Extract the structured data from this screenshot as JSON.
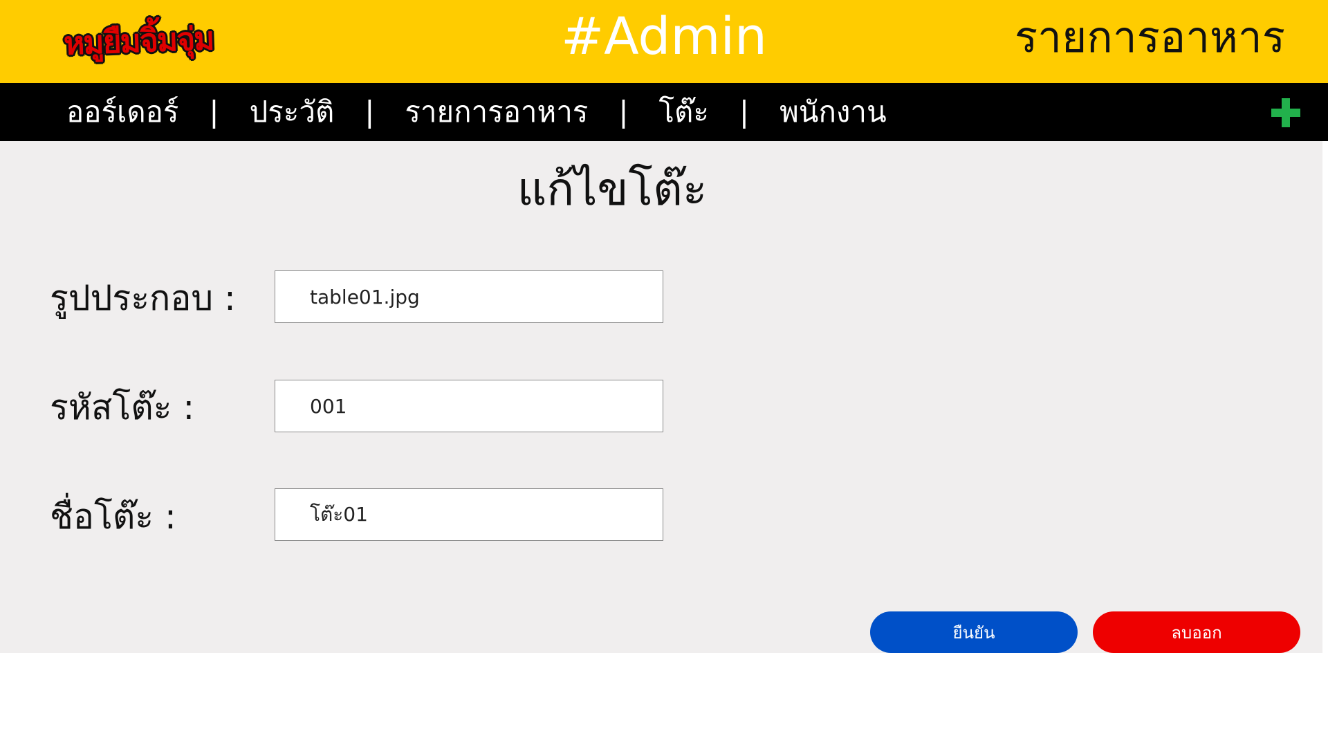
{
  "header": {
    "logo_text": "หมูยืมจิ้มจุ่ม",
    "title": "#Admin",
    "page_heading": "รายการอาหาร"
  },
  "nav": {
    "items": [
      {
        "label": "ออร์เดอร์"
      },
      {
        "label": "ประวัติ"
      },
      {
        "label": "รายการอาหาร"
      },
      {
        "label": "โต๊ะ"
      },
      {
        "label": "พนักงาน"
      }
    ],
    "separator": "|",
    "add_icon": "plus-icon",
    "add_icon_color": "#22b14c"
  },
  "form": {
    "title": "แก้ไขโต๊ะ",
    "fields": [
      {
        "label": "รูปประกอบ :",
        "value": "table01.jpg"
      },
      {
        "label": "รหัสโต๊ะ :",
        "value": "001"
      },
      {
        "label": "ชื่อโต๊ะ :",
        "value": "โต๊ะ01"
      }
    ],
    "confirm_label": "ยืนยัน",
    "delete_label": "ลบออก"
  },
  "colors": {
    "header_bg": "#FFCC00",
    "nav_bg": "#000000",
    "content_bg": "#F0EEEE",
    "confirm": "#0050C8",
    "delete": "#EE0000"
  }
}
